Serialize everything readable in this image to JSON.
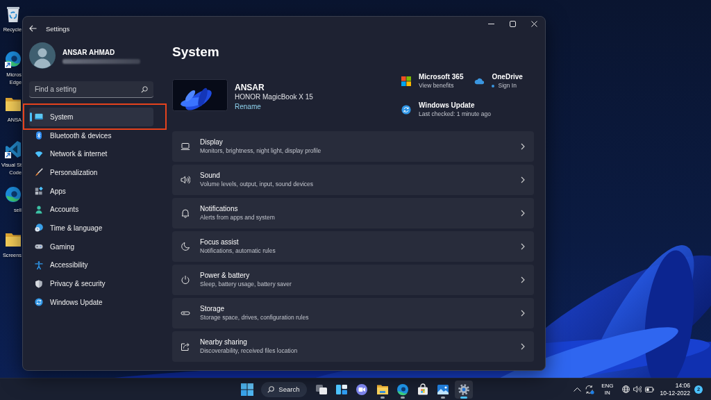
{
  "desktop": {
    "icons": [
      {
        "kind": "recycle-bin",
        "lines": [
          "Recycle"
        ],
        "shortcut": false
      },
      {
        "kind": "edge",
        "lines": [
          "Micros",
          "Edge"
        ],
        "shortcut": true
      },
      {
        "kind": "folder",
        "lines": [
          "ANSA"
        ],
        "shortcut": false
      },
      {
        "kind": "vscode",
        "lines": [
          "Visual St",
          "Code"
        ],
        "shortcut": true
      },
      {
        "kind": "edge",
        "lines": [
          "sell"
        ],
        "shortcut": false
      },
      {
        "kind": "folder",
        "lines": [
          "Screens"
        ],
        "shortcut": false
      }
    ]
  },
  "window": {
    "title": "Settings"
  },
  "account": {
    "name": "ANSAR AHMAD",
    "email_blurred": true
  },
  "search": {
    "placeholder": "Find a setting"
  },
  "sidebar": {
    "items": [
      {
        "kind": "system",
        "label": "System",
        "selected": true,
        "highlighted": true
      },
      {
        "kind": "bluetooth",
        "label": "Bluetooth & devices",
        "selected": false,
        "highlighted": false
      },
      {
        "kind": "network",
        "label": "Network & internet",
        "selected": false,
        "highlighted": false
      },
      {
        "kind": "personalization",
        "label": "Personalization",
        "selected": false,
        "highlighted": false
      },
      {
        "kind": "apps",
        "label": "Apps",
        "selected": false,
        "highlighted": false
      },
      {
        "kind": "accounts",
        "label": "Accounts",
        "selected": false,
        "highlighted": false
      },
      {
        "kind": "time-language",
        "label": "Time & language",
        "selected": false,
        "highlighted": false
      },
      {
        "kind": "gaming",
        "label": "Gaming",
        "selected": false,
        "highlighted": false
      },
      {
        "kind": "accessibility",
        "label": "Accessibility",
        "selected": false,
        "highlighted": false
      },
      {
        "kind": "privacy",
        "label": "Privacy & security",
        "selected": false,
        "highlighted": false
      },
      {
        "kind": "windows-update",
        "label": "Windows Update",
        "selected": false,
        "highlighted": false
      }
    ]
  },
  "page": {
    "title": "System"
  },
  "device": {
    "name": "ANSAR",
    "model": "HONOR MagicBook X 15",
    "rename": "Rename"
  },
  "services": [
    {
      "kind": "microsoft-365",
      "title": "Microsoft 365",
      "subtitle": "View benefits",
      "status_dot": false
    },
    {
      "kind": "onedrive",
      "title": "OneDrive",
      "subtitle": "Sign In",
      "status_dot": true
    },
    {
      "kind": "windows-update",
      "title": "Windows Update",
      "subtitle": "Last checked: 1 minute ago",
      "status_dot": false
    }
  ],
  "settings": [
    {
      "kind": "display",
      "title": "Display",
      "subtitle": "Monitors, brightness, night light, display profile"
    },
    {
      "kind": "sound",
      "title": "Sound",
      "subtitle": "Volume levels, output, input, sound devices"
    },
    {
      "kind": "notifications",
      "title": "Notifications",
      "subtitle": "Alerts from apps and system"
    },
    {
      "kind": "focus-assist",
      "title": "Focus assist",
      "subtitle": "Notifications, automatic rules"
    },
    {
      "kind": "power",
      "title": "Power & battery",
      "subtitle": "Sleep, battery usage, battery saver"
    },
    {
      "kind": "storage",
      "title": "Storage",
      "subtitle": "Storage space, drives, configuration rules"
    },
    {
      "kind": "nearby-sharing",
      "title": "Nearby sharing",
      "subtitle": "Discoverability, received files location"
    }
  ],
  "taskbar": {
    "search_label": "Search",
    "apps": [
      {
        "kind": "task-view",
        "running": false,
        "selected": false
      },
      {
        "kind": "widgets",
        "running": false,
        "selected": false
      },
      {
        "kind": "chat",
        "running": false,
        "selected": false
      },
      {
        "kind": "file-explorer",
        "running": true,
        "selected": false
      },
      {
        "kind": "edge",
        "running": true,
        "selected": false
      },
      {
        "kind": "store",
        "running": false,
        "selected": false
      },
      {
        "kind": "photos",
        "running": true,
        "selected": false
      },
      {
        "kind": "settings",
        "running": true,
        "selected": true
      }
    ],
    "tray": {
      "language": "ENG",
      "region": "IN",
      "time": "14:06",
      "date": "10-12-2022",
      "notification_count": "2"
    }
  }
}
